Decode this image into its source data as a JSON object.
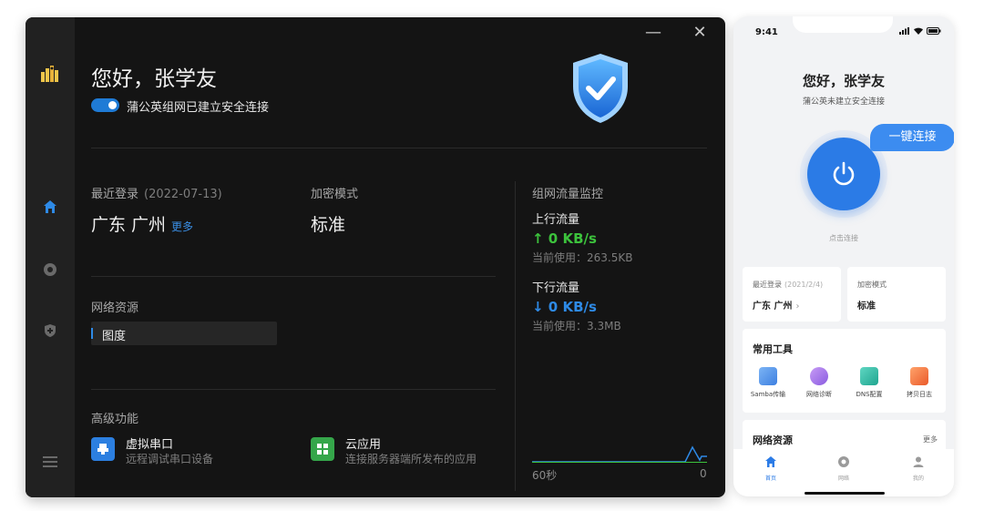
{
  "desktop": {
    "greeting": "您好，张学友",
    "connection_status": "蒲公英组网已建立安全连接",
    "last_login": {
      "label": "最近登录",
      "date": "(2022-07-13)",
      "location": "广东 广州",
      "more": "更多"
    },
    "encryption": {
      "label": "加密模式",
      "value": "标准"
    },
    "resources": {
      "label": "网络资源",
      "items": [
        "图度"
      ]
    },
    "advanced": {
      "label": "高级功能",
      "items": [
        {
          "title": "虚拟串口",
          "subtitle": "远程调试串口设备"
        },
        {
          "title": "云应用",
          "subtitle": "连接服务器端所发布的应用"
        }
      ]
    },
    "traffic": {
      "label": "组网流量监控",
      "upload": {
        "label": "上行流量",
        "value": "↑ 0 KB/s",
        "used": "当前使用：263.5KB"
      },
      "download": {
        "label": "下行流量",
        "value": "↓ 0 KB/s",
        "used": "当前使用：3.3MB"
      },
      "axis_left": "60秒",
      "axis_right": "0"
    },
    "window_controls": {
      "minimize": "—",
      "close": "✕"
    }
  },
  "mobile": {
    "time": "9:41",
    "greeting": "您好，张学友",
    "status": "蒲公英未建立安全连接",
    "connect_bubble": "一键连接",
    "tap_hint": "点击连接",
    "last_login": {
      "label": "最近登录",
      "date": "(2021/2/4)",
      "location": "广东 广州"
    },
    "encryption": {
      "label": "加密模式",
      "value": "标准"
    },
    "tools": {
      "label": "常用工具",
      "items": [
        "Samba传输",
        "网络诊断",
        "DNS配置",
        "拷贝日志"
      ]
    },
    "resources": {
      "label": "网络资源",
      "more": "更多"
    },
    "tabs": [
      "首页",
      "网络",
      "我的"
    ]
  },
  "colors": {
    "accent_blue": "#2b7be6",
    "upload_green": "#3cc23c",
    "download_blue": "#2e8ae6"
  }
}
